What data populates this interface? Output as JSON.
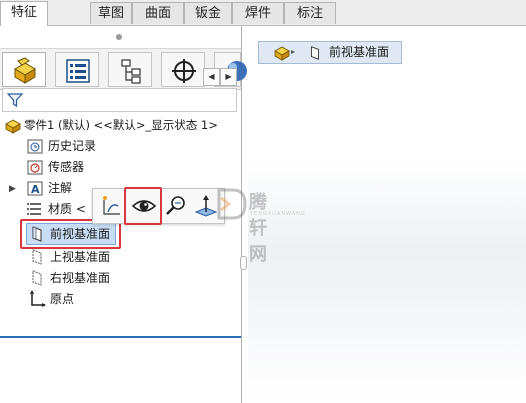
{
  "tabs": [
    "特征",
    "草图",
    "曲面",
    "钣金",
    "焊件",
    "标注"
  ],
  "active_tab_index": 0,
  "icon_tabs": [
    "feature-manager-icon",
    "property-manager-icon",
    "configuration-manager-icon",
    "dimxpert-icon",
    "appearance-icon"
  ],
  "scroll_arrows": {
    "left": "◀",
    "right": "▶"
  },
  "tree": {
    "root": "零件1 (默认) <<默认>_显示状态 1>",
    "items": {
      "history": "历史记录",
      "sensors": "传感器",
      "annotations": "注解",
      "material": "材质 <未指定>",
      "front_plane": "前视基准面",
      "top_plane": "上视基准面",
      "right_plane": "右视基准面",
      "origin": "原点"
    }
  },
  "context_toolbar": [
    "normal-to-sketch-icon",
    "show-hide-eye-icon",
    "zoom-to-selection-icon",
    "view-normal-icon"
  ],
  "canvas": {
    "plane_label": "前视基准面"
  },
  "watermark": {
    "brand": "腾轩网",
    "sub": "TENGXUANWANG"
  },
  "colors": {
    "highlight_red": "#d9363e",
    "selection_blue": "#c9def5",
    "accent_blue": "#2a6fb6",
    "part_yellow": "#f0c419"
  }
}
